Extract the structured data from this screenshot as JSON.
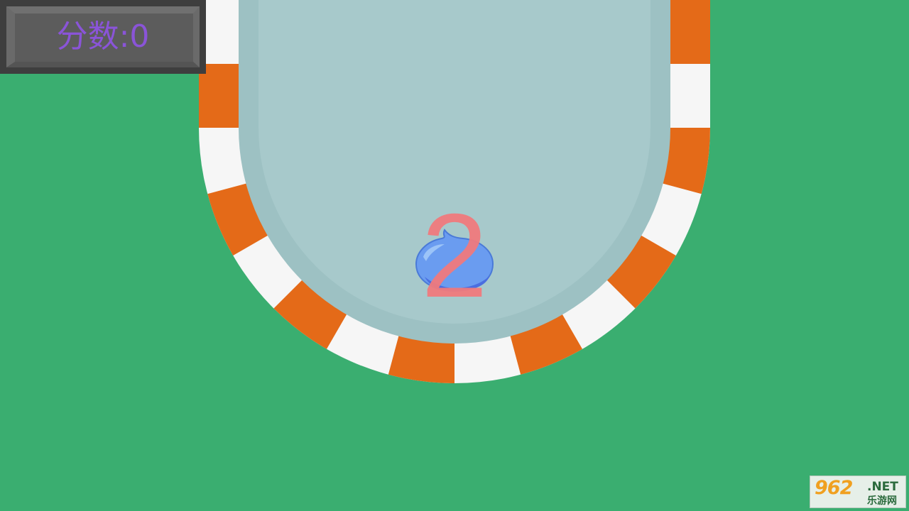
{
  "score": {
    "label": "分数",
    "separator": ":",
    "value": "0"
  },
  "countdown": {
    "value": "2"
  },
  "watermark": {
    "number": "962",
    "domain": ".NET",
    "site_name": "乐游网"
  },
  "colors": {
    "background": "#3aae70",
    "track_surface": "#a7c9cb",
    "track_shade": "#9dc1c3",
    "stripe_orange": "#e46a18",
    "stripe_white": "#f6f6f6",
    "score_text": "#8a54d8",
    "countdown_text": "#f07a7e",
    "player": "#6a9cf0"
  },
  "icons": {
    "player": "water-drop-slime-icon",
    "watermark_logo": "962-logo-icon"
  }
}
